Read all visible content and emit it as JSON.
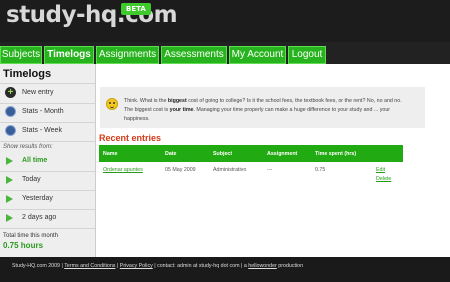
{
  "header": {
    "logo": "study-hq",
    "logo_suffix": ".com",
    "badge": "BETA"
  },
  "nav": [
    {
      "label": "Subjects"
    },
    {
      "label": "Timelogs"
    },
    {
      "label": "Assignments"
    },
    {
      "label": "Assessments"
    },
    {
      "label": "My Account"
    },
    {
      "label": "Logout"
    }
  ],
  "sidebar": {
    "title": "Timelogs",
    "actions": [
      {
        "label": "New entry",
        "icon": "plus-icon"
      },
      {
        "label": "Stats - Month",
        "icon": "stats-icon"
      },
      {
        "label": "Stats - Week",
        "icon": "stats-icon"
      }
    ],
    "show_label": "Show results from:",
    "filters": [
      {
        "label": "All time"
      },
      {
        "label": "Today"
      },
      {
        "label": "Yesterday"
      },
      {
        "label": "2 days ago"
      }
    ],
    "total_label": "Total time this month",
    "total_value": "0.75 hours"
  },
  "tip": {
    "line1_a": "Think. What is the ",
    "line1_b": "biggest",
    "line1_c": " cost of going to college? Is it the school fees, the textbook fees, or the rent? No, no and no.",
    "line2_a": "The biggest cost is ",
    "line2_b": "your time",
    "line2_c": ". Managing your time properly can make a huge difference to your study and ... your",
    "line3": "happiness."
  },
  "recent": {
    "title": "Recent entries",
    "columns": [
      "Name",
      "Date",
      "Subject",
      "Assignment",
      "Time spent (hrs)"
    ],
    "rows": [
      {
        "name": "Ordenar apuntes",
        "date": "05 May 2009",
        "subject": "Administrativo",
        "assignment": "---",
        "time": "0.75",
        "edit": "Edit",
        "delete": "Delete"
      }
    ]
  },
  "footer": {
    "copy": "Study-HQ.com 2009 | ",
    "terms": "Terms and Conditions",
    "sep1": " | ",
    "privacy": "Privacy Policy",
    "contact": " | contact: admin at study-hq dot com | a ",
    "maker": "hellowonder",
    "production": " production"
  },
  "colors": {
    "accent": "#27b31d",
    "header_bg": "#1c1c1c",
    "recent_title": "#d33a16"
  }
}
